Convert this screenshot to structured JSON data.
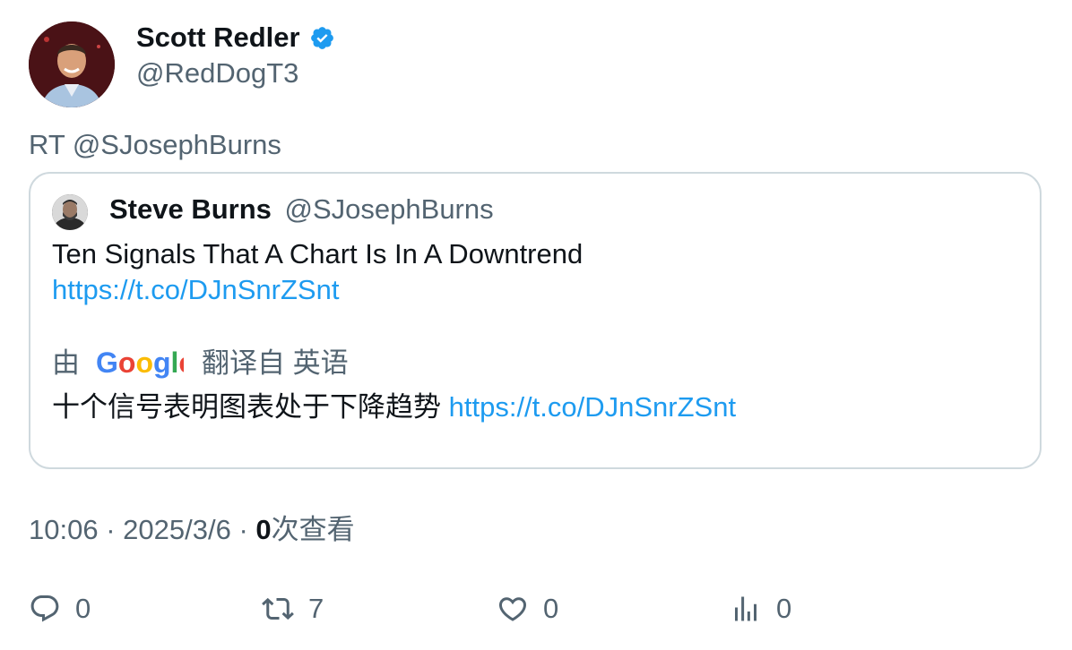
{
  "author": {
    "name": "Scott Redler",
    "handle": "@RedDogT3",
    "verified_icon": "verified-badge-icon"
  },
  "retweet_line": "RT @SJosephBurns",
  "quoted": {
    "name": "Steve Burns",
    "handle": "@SJosephBurns",
    "text": "Ten Signals That A Chart Is In A Downtrend",
    "link": "https://t.co/DJnSnrZSnt",
    "translate_prefix": "由",
    "translate_brand": "Google",
    "translate_suffix": "翻译自 英语",
    "translated_text": "十个信号表明图表处于下降趋势",
    "translated_link": "https://t.co/DJnSnrZSnt"
  },
  "meta": {
    "time": "10:06",
    "date": "2025/3/6",
    "separator": "·",
    "views_count": "0",
    "views_label": "次查看"
  },
  "actions": {
    "reply_count": "0",
    "retweet_count": "7",
    "like_count": "0",
    "views_count": "0"
  },
  "colors": {
    "link": "#1d9bf0",
    "secondary_text": "#536471",
    "border": "#cfd9de"
  }
}
